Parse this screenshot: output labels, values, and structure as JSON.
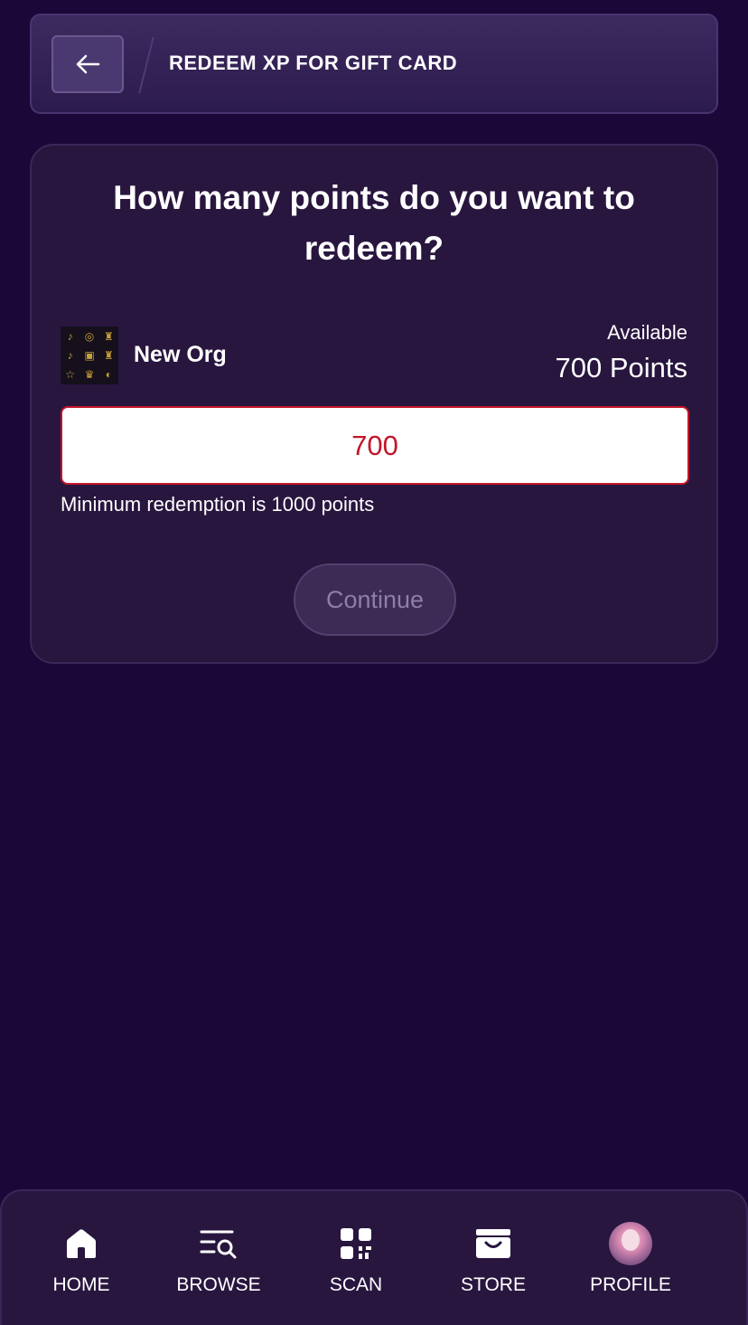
{
  "header": {
    "title": "REDEEM XP FOR GIFT CARD",
    "back_icon": "arrow-left-icon"
  },
  "redeem": {
    "question": "How many points do you want to redeem?",
    "org_name": "New Org",
    "available_label": "Available",
    "available_points": "700 Points",
    "input_value": "700",
    "minimum_note": "Minimum redemption is 1000 points",
    "continue_label": "Continue",
    "error_color": "#c3152a"
  },
  "nav": {
    "items": [
      {
        "label": "HOME",
        "icon": "home-icon"
      },
      {
        "label": "BROWSE",
        "icon": "browse-icon"
      },
      {
        "label": "SCAN",
        "icon": "qr-scan-icon"
      },
      {
        "label": "STORE",
        "icon": "store-basket-icon"
      },
      {
        "label": "PROFILE",
        "icon": "avatar"
      }
    ]
  }
}
